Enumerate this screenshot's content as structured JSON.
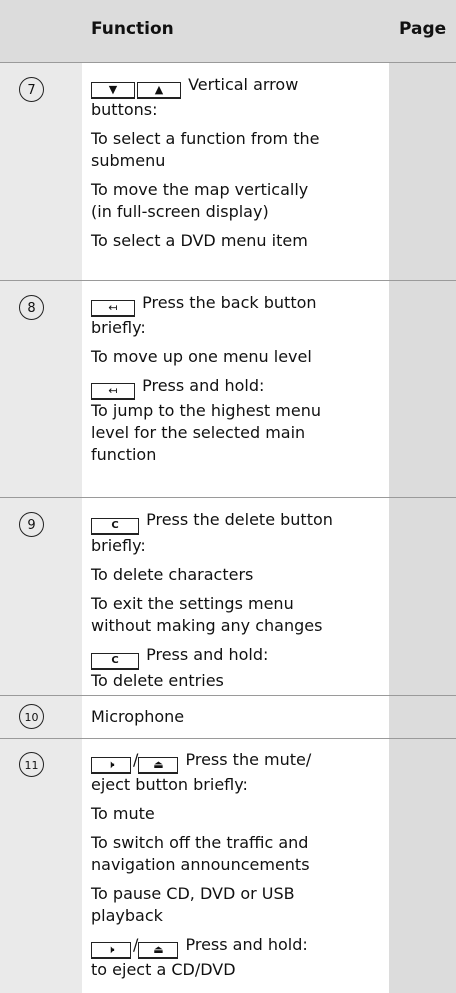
{
  "header": {
    "function": "Function",
    "page": "Page"
  },
  "rows": [
    {
      "num": "7",
      "keys": [
        "▼",
        "▲"
      ],
      "keys_text": "Vertical arrow",
      "line2": "buttons:",
      "lines": [
        "To select a function from the",
        "submenu",
        "To move the map vertically",
        "(in full-screen display)",
        "To select a DVD menu item"
      ]
    },
    {
      "num": "8",
      "key_back": "↤",
      "key_text": "Press the back button",
      "line2": "briefly:",
      "line3": "To move up one menu level",
      "hold_text": "Press and hold:",
      "lines": [
        "To jump to the highest menu",
        "level for the selected main",
        "function"
      ]
    },
    {
      "num": "9",
      "key_c": "C",
      "key_text": "Press the delete button",
      "line2": "briefly:",
      "lines1": [
        "To delete characters",
        "To exit the settings menu",
        "without making any changes"
      ],
      "hold_text": "Press and hold:",
      "line_last": "To delete entries"
    },
    {
      "num": "10",
      "text": "Microphone"
    },
    {
      "num": "11",
      "key_mute": "🕨",
      "slash": "/",
      "key_eject": "⏏",
      "key_text": "Press the mute/",
      "line2": "eject button briefly:",
      "lines": [
        "To mute",
        "To switch off the traffic and",
        "navigation announcements",
        "To pause CD, DVD or USB",
        "playback"
      ],
      "hold_text": "Press and hold:",
      "line_last": "to eject a CD/DVD"
    }
  ]
}
